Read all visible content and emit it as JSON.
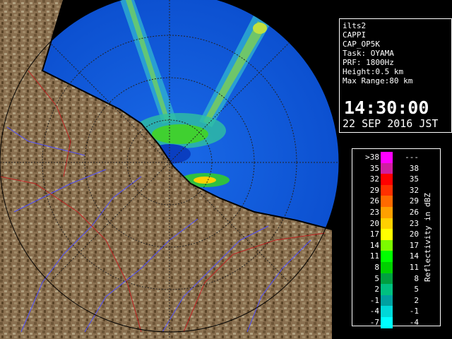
{
  "info": {
    "station": "ilts2",
    "product": "CAPPI",
    "product_code": "CAP_OP5K",
    "task": "Task: OYAMA",
    "prf": "PRF: 1800Hz",
    "height": "Height:0.5 km",
    "max_range": "Max Range:80 km",
    "time": "14:30:00",
    "date": "22 SEP 2016 JST"
  },
  "legend": {
    "unit_label": "Reflectivity in dBZ",
    "rows": [
      {
        "low": ">38",
        "high": "---",
        "color": "#ff00ff"
      },
      {
        "low": "35",
        "high": "38",
        "color": "#d01ea0"
      },
      {
        "low": "32",
        "high": "35",
        "color": "#ff0000"
      },
      {
        "low": "29",
        "high": "32",
        "color": "#ff3000"
      },
      {
        "low": "26",
        "high": "29",
        "color": "#ff6a00"
      },
      {
        "low": "23",
        "high": "26",
        "color": "#ffa000"
      },
      {
        "low": "20",
        "high": "23",
        "color": "#ffd000"
      },
      {
        "low": "17",
        "high": "20",
        "color": "#ffff00"
      },
      {
        "low": "14",
        "high": "17",
        "color": "#7cfc00"
      },
      {
        "low": "11",
        "high": "14",
        "color": "#00ff00"
      },
      {
        "low": "8",
        "high": "11",
        "color": "#00d000"
      },
      {
        "low": "5",
        "high": "8",
        "color": "#00a040"
      },
      {
        "low": "2",
        "high": "5",
        "color": "#00c080"
      },
      {
        "low": "-1",
        "high": "2",
        "color": "#00a0a0"
      },
      {
        "low": "-4",
        "high": "-1",
        "color": "#00d8d8"
      },
      {
        "low": "-7",
        "high": "-4",
        "color": "#00ffff"
      }
    ]
  },
  "map": {
    "sea_color": "#1060e0",
    "terrain_color": "#8a7050",
    "coast_color": "#000000",
    "river_color": "#5050ff",
    "boundary_color": "#c02020"
  }
}
